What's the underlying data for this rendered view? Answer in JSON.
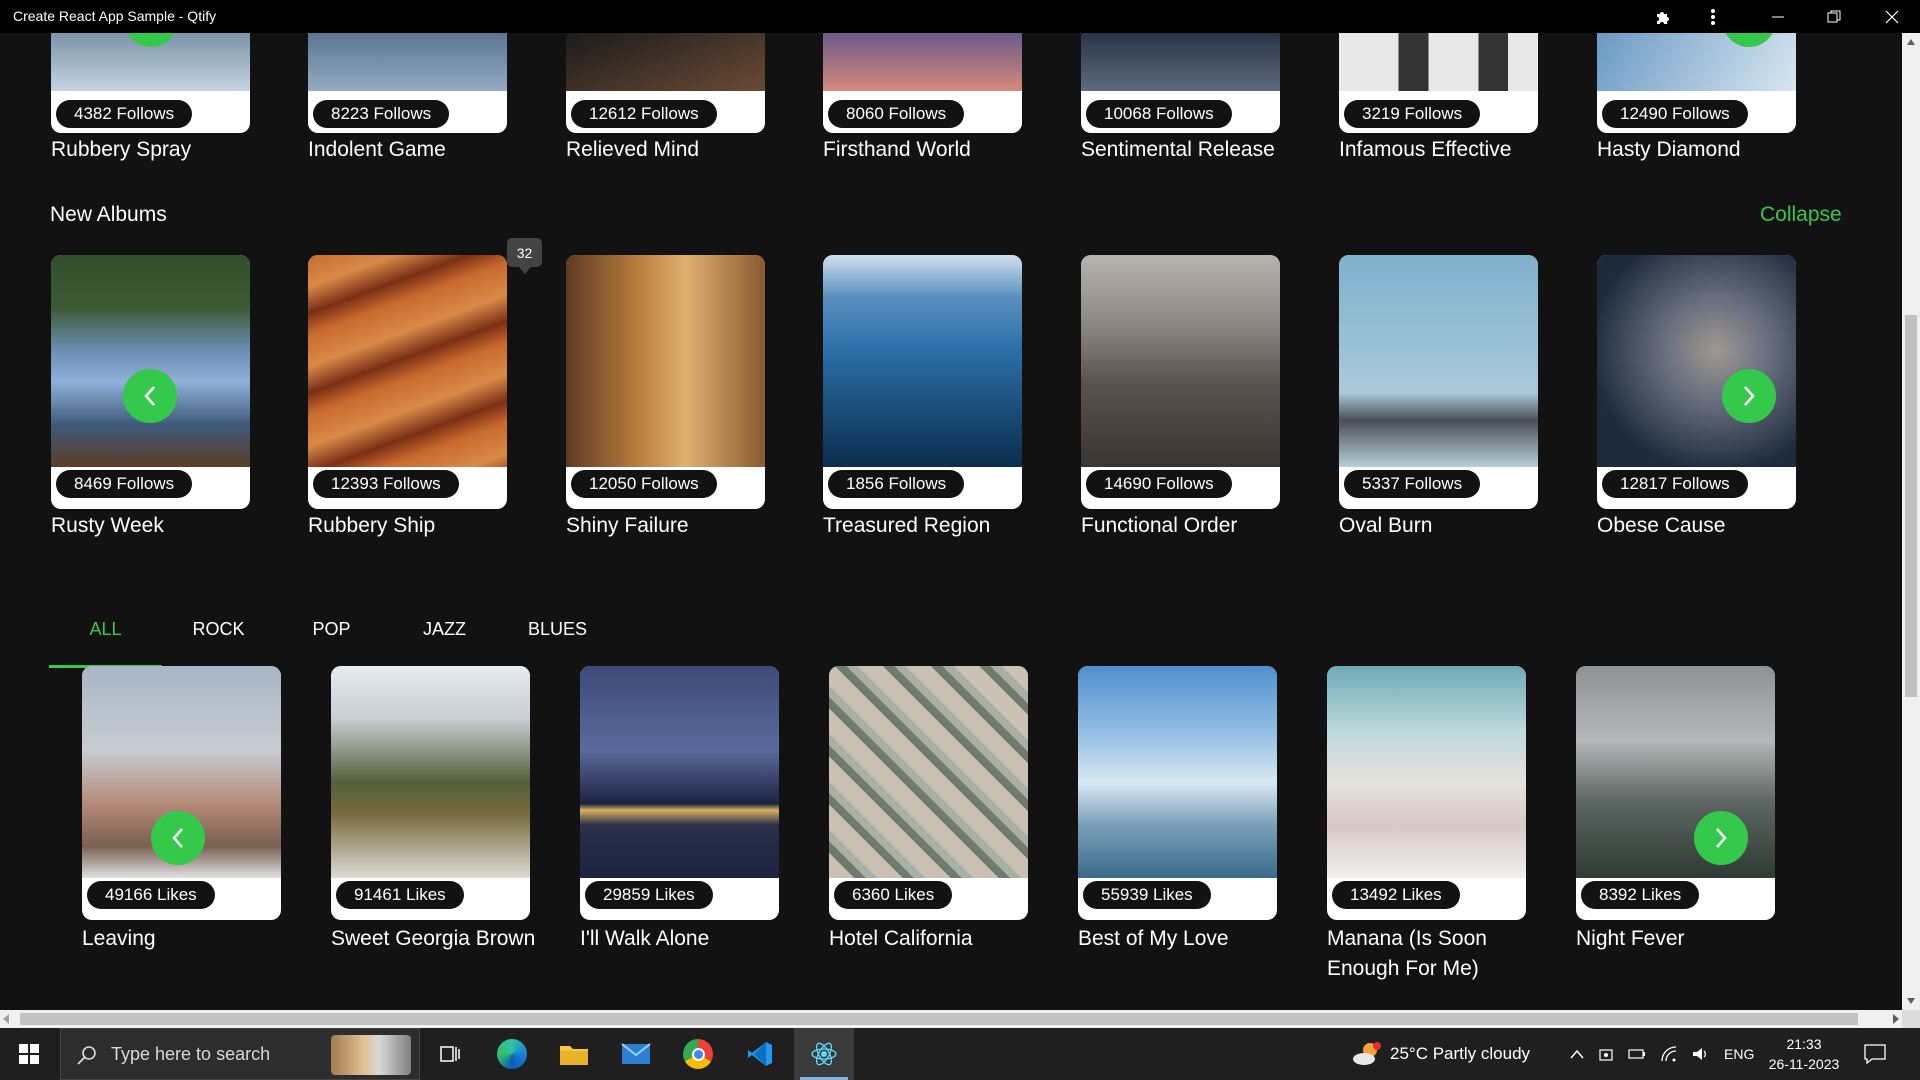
{
  "window": {
    "title": "Create React App Sample - Qtify"
  },
  "top_albums": [
    {
      "follows": "4382 Follows",
      "name": "Rubbery Spray",
      "colors": [
        "#7c93a8",
        "#c5d4e2"
      ]
    },
    {
      "follows": "8223 Follows",
      "name": "Indolent Game",
      "colors": [
        "#5b7693",
        "#94abc2"
      ]
    },
    {
      "follows": "12612 Follows",
      "name": "Relieved Mind",
      "colors": [
        "#1b1b1b",
        "#6b4a35"
      ]
    },
    {
      "follows": "8060 Follows",
      "name": "Firsthand World",
      "colors": [
        "#6b5a8a",
        "#d68a7a"
      ]
    },
    {
      "follows": "10068 Follows",
      "name": "Sentimental Release",
      "colors": [
        "#2a3448",
        "#5e6a80"
      ]
    },
    {
      "follows": "3219 Follows",
      "name": "Infamous Effective",
      "colors": [
        "#e8e8e8",
        "#333333"
      ]
    },
    {
      "follows": "12490 Follows",
      "name": "Hasty Diamond",
      "colors": [
        "#6b9ac4",
        "#d8e6f0"
      ]
    }
  ],
  "new_albums": {
    "title": "New Albums",
    "collapse_label": "Collapse",
    "tooltip": "32",
    "items": [
      {
        "follows": "8469 Follows",
        "name": "Rusty Week",
        "colors": [
          "#2f4f2a",
          "#6d8db3"
        ]
      },
      {
        "follows": "12393 Follows",
        "name": "Rubbery Ship",
        "colors": [
          "#c8692d",
          "#7a2f14"
        ]
      },
      {
        "follows": "12050 Follows",
        "name": "Shiny Failure",
        "colors": [
          "#b67a3c",
          "#5e3a22"
        ]
      },
      {
        "follows": "1856 Follows",
        "name": "Treasured Region",
        "colors": [
          "#2b6ea6",
          "#0b2d4d"
        ]
      },
      {
        "follows": "14690 Follows",
        "name": "Functional Order",
        "colors": [
          "#8a8480",
          "#3a3532"
        ]
      },
      {
        "follows": "5337 Follows",
        "name": "Oval Burn",
        "colors": [
          "#7fb0cc",
          "#b7cfdb"
        ]
      },
      {
        "follows": "12817 Follows",
        "name": "Obese Cause",
        "colors": [
          "#1d2a3b",
          "#6a7080"
        ]
      }
    ]
  },
  "tabs": {
    "items": [
      "ALL",
      "ROCK",
      "POP",
      "JAZZ",
      "BLUES"
    ],
    "active": "ALL"
  },
  "songs": [
    {
      "likes": "49166 Likes",
      "name": "Leaving",
      "colors": [
        "#a8b6c4",
        "#7a5f52"
      ]
    },
    {
      "likes": "91461 Likes",
      "name": "Sweet Georgia Brown",
      "colors": [
        "#c7cdd2",
        "#51603a"
      ]
    },
    {
      "likes": "29859 Likes",
      "name": "I'll Walk Alone",
      "colors": [
        "#3e4a78",
        "#1c2340"
      ]
    },
    {
      "likes": "6360 Likes",
      "name": "Hotel California",
      "colors": [
        "#6f7a6e",
        "#c9c2b3"
      ]
    },
    {
      "likes": "55939 Likes",
      "name": "Best of My Love",
      "colors": [
        "#4f8fcf",
        "#d8e8f2"
      ]
    },
    {
      "likes": "13492 Likes",
      "name": "Manana (Is Soon Enough For Me)",
      "colors": [
        "#6fa9b5",
        "#e6e2dc"
      ]
    },
    {
      "likes": "8392 Likes",
      "name": "Night Fever",
      "colors": [
        "#8e9294",
        "#2f3a35"
      ]
    }
  ],
  "taskbar": {
    "search_placeholder": "Type here to search",
    "weather": "25°C  Partly cloudy",
    "lang": "ENG",
    "time": "21:33",
    "date": "26-11-2023"
  },
  "accent_color": "#34c94a"
}
